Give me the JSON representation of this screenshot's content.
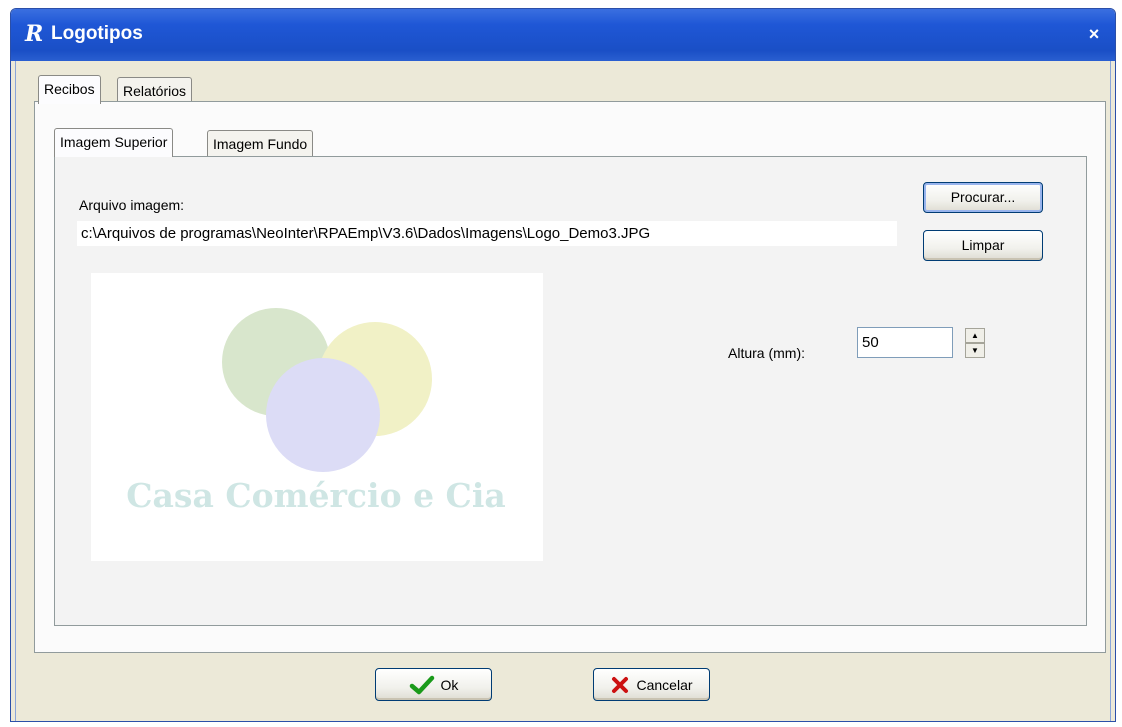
{
  "window": {
    "title": "Logotipos",
    "close_glyph": "×",
    "app_icon_glyph": "R"
  },
  "outer_tabs": [
    {
      "label": "Recibos",
      "active": true
    },
    {
      "label": "Relatórios",
      "active": false
    }
  ],
  "inner_tabs": [
    {
      "label": "Imagem Superior",
      "active": true
    },
    {
      "label": "Imagem Fundo",
      "active": false
    }
  ],
  "image_file": {
    "label": "Arquivo imagem:",
    "value": "c:\\Arquivos de programas\\NeoInter\\RPAEmp\\V3.6\\Dados\\Imagens\\Logo_Demo3.JPG"
  },
  "buttons": {
    "browse": "Procurar...",
    "clear": "Limpar",
    "ok": "Ok",
    "cancel": "Cancelar"
  },
  "height": {
    "label": "Altura (mm):",
    "value": "50"
  },
  "logo_preview": {
    "text": "Casa Comércio e Cia",
    "colors": {
      "green_circle": "#d8e6cc",
      "yellow_circle": "#f1f1c6",
      "purple_circle": "#dcdcf6",
      "text": "#cfe6e4"
    }
  },
  "icons": {
    "ok": "check-icon",
    "cancel": "x-icon"
  }
}
